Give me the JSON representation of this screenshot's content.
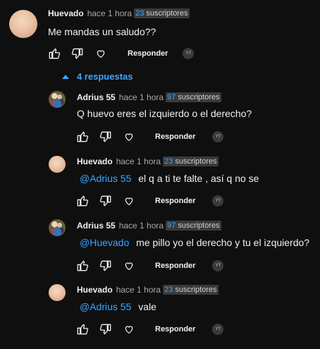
{
  "comments": [
    {
      "author": "Huevado",
      "time": "hace 1 hora",
      "subs_count": "23",
      "subs_label": "suscriptores",
      "mention": "",
      "text": "Me mandas un saludo??",
      "reply_label": "Responder",
      "avatar": "egg"
    },
    {
      "author": "Adrius 55",
      "time": "hace 1 hora",
      "subs_count": "97",
      "subs_label": "suscriptores",
      "mention": "",
      "text": "Q huevo eres el izquierdo o el derecho?",
      "reply_label": "Responder",
      "avatar": "anime"
    },
    {
      "author": "Huevado",
      "time": "hace 1 hora",
      "subs_count": "23",
      "subs_label": "suscriptores",
      "mention": "@Adrius 55",
      "text": "el q a ti te falte , así q no se",
      "reply_label": "Responder",
      "avatar": "egg"
    },
    {
      "author": "Adrius 55",
      "time": "hace 1 hora",
      "subs_count": "97",
      "subs_label": "suscriptores",
      "mention": "@Huevado",
      "text": "me pillo yo el derecho y tu el izquierdo?",
      "reply_label": "Responder",
      "avatar": "anime"
    },
    {
      "author": "Huevado",
      "time": "hace 1 hora",
      "subs_count": "23",
      "subs_label": "suscriptores",
      "mention": "@Adrius 55",
      "text": "vale",
      "reply_label": "Responder",
      "avatar": "egg"
    }
  ],
  "replies_toggle": {
    "label": "4 respuestas",
    "icon": "chevron-up-icon"
  },
  "colors": {
    "background": "#0f0f0f",
    "link": "#3ea6ff",
    "text": "#f1f1f1",
    "muted": "#aaaaaa"
  },
  "icons": [
    "like-icon",
    "dislike-icon",
    "heart-icon",
    "creator-avatar-icon"
  ]
}
